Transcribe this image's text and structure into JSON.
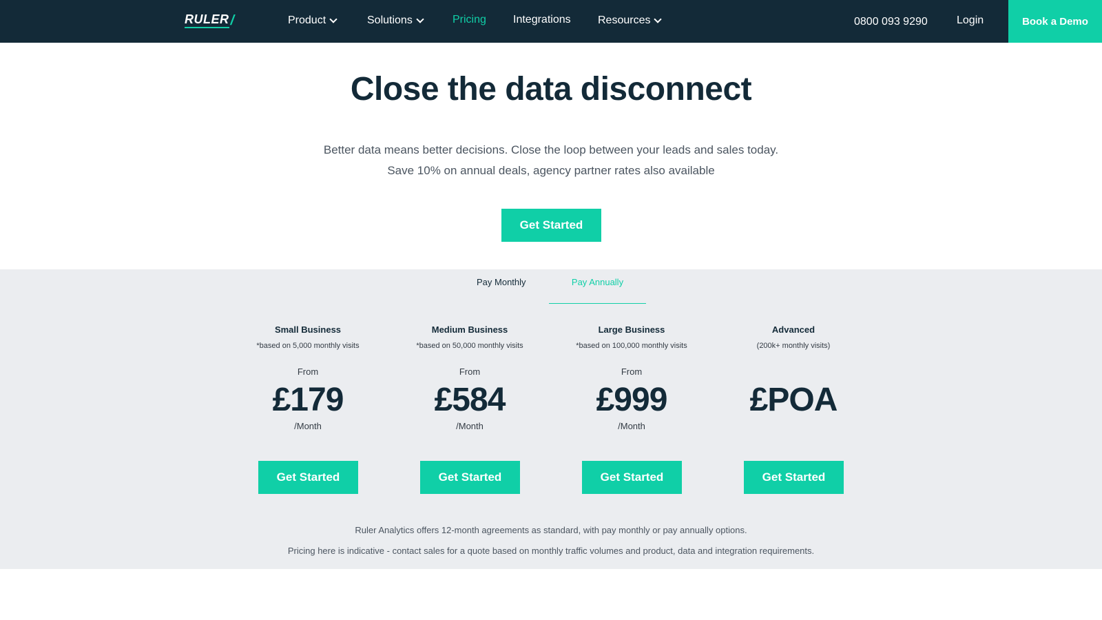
{
  "nav": {
    "logo_text": "RULER",
    "logo_slash": "/",
    "items": [
      {
        "label": "Product",
        "has_dropdown": true
      },
      {
        "label": "Solutions",
        "has_dropdown": true
      },
      {
        "label": "Pricing",
        "active": true
      },
      {
        "label": "Integrations"
      },
      {
        "label": "Resources",
        "has_dropdown": true
      }
    ],
    "phone": "0800 093 9290",
    "login": "Login",
    "demo_button": "Book a Demo"
  },
  "hero": {
    "title": "Close the data disconnect",
    "subtitle_line1": "Better data means better decisions. Close the loop between your leads and sales today.",
    "subtitle_line2": "Save 10% on annual deals, agency partner rates also available",
    "cta": "Get Started"
  },
  "billing_toggle": {
    "monthly": "Pay Monthly",
    "annually": "Pay Annually",
    "selected": "annually"
  },
  "plans": [
    {
      "name": "Small Business",
      "note": "*based on 5,000 monthly visits",
      "from": "From",
      "price": "£179",
      "period": "/Month",
      "cta": "Get Started"
    },
    {
      "name": "Medium Business",
      "note": "*based on 50,000 monthly visits",
      "from": "From",
      "price": "£584",
      "period": "/Month",
      "cta": "Get Started"
    },
    {
      "name": "Large Business",
      "note": "*based on 100,000 monthly visits",
      "from": "From",
      "price": "£999",
      "period": "/Month",
      "cta": "Get Started"
    },
    {
      "name": "Advanced",
      "note": "(200k+ monthly visits)",
      "price": "£POA",
      "cta": "Get Started"
    }
  ],
  "footnotes": {
    "line1": "Ruler Analytics offers 12-month agreements as standard, with pay monthly or pay annually options.",
    "line2": "Pricing here is indicative - contact sales for a quote based on monthly traffic volumes and product, data and integration requirements."
  },
  "colors": {
    "nav_bg": "#132a38",
    "accent": "#10cfa7",
    "pricing_bg": "#ebedf0"
  }
}
